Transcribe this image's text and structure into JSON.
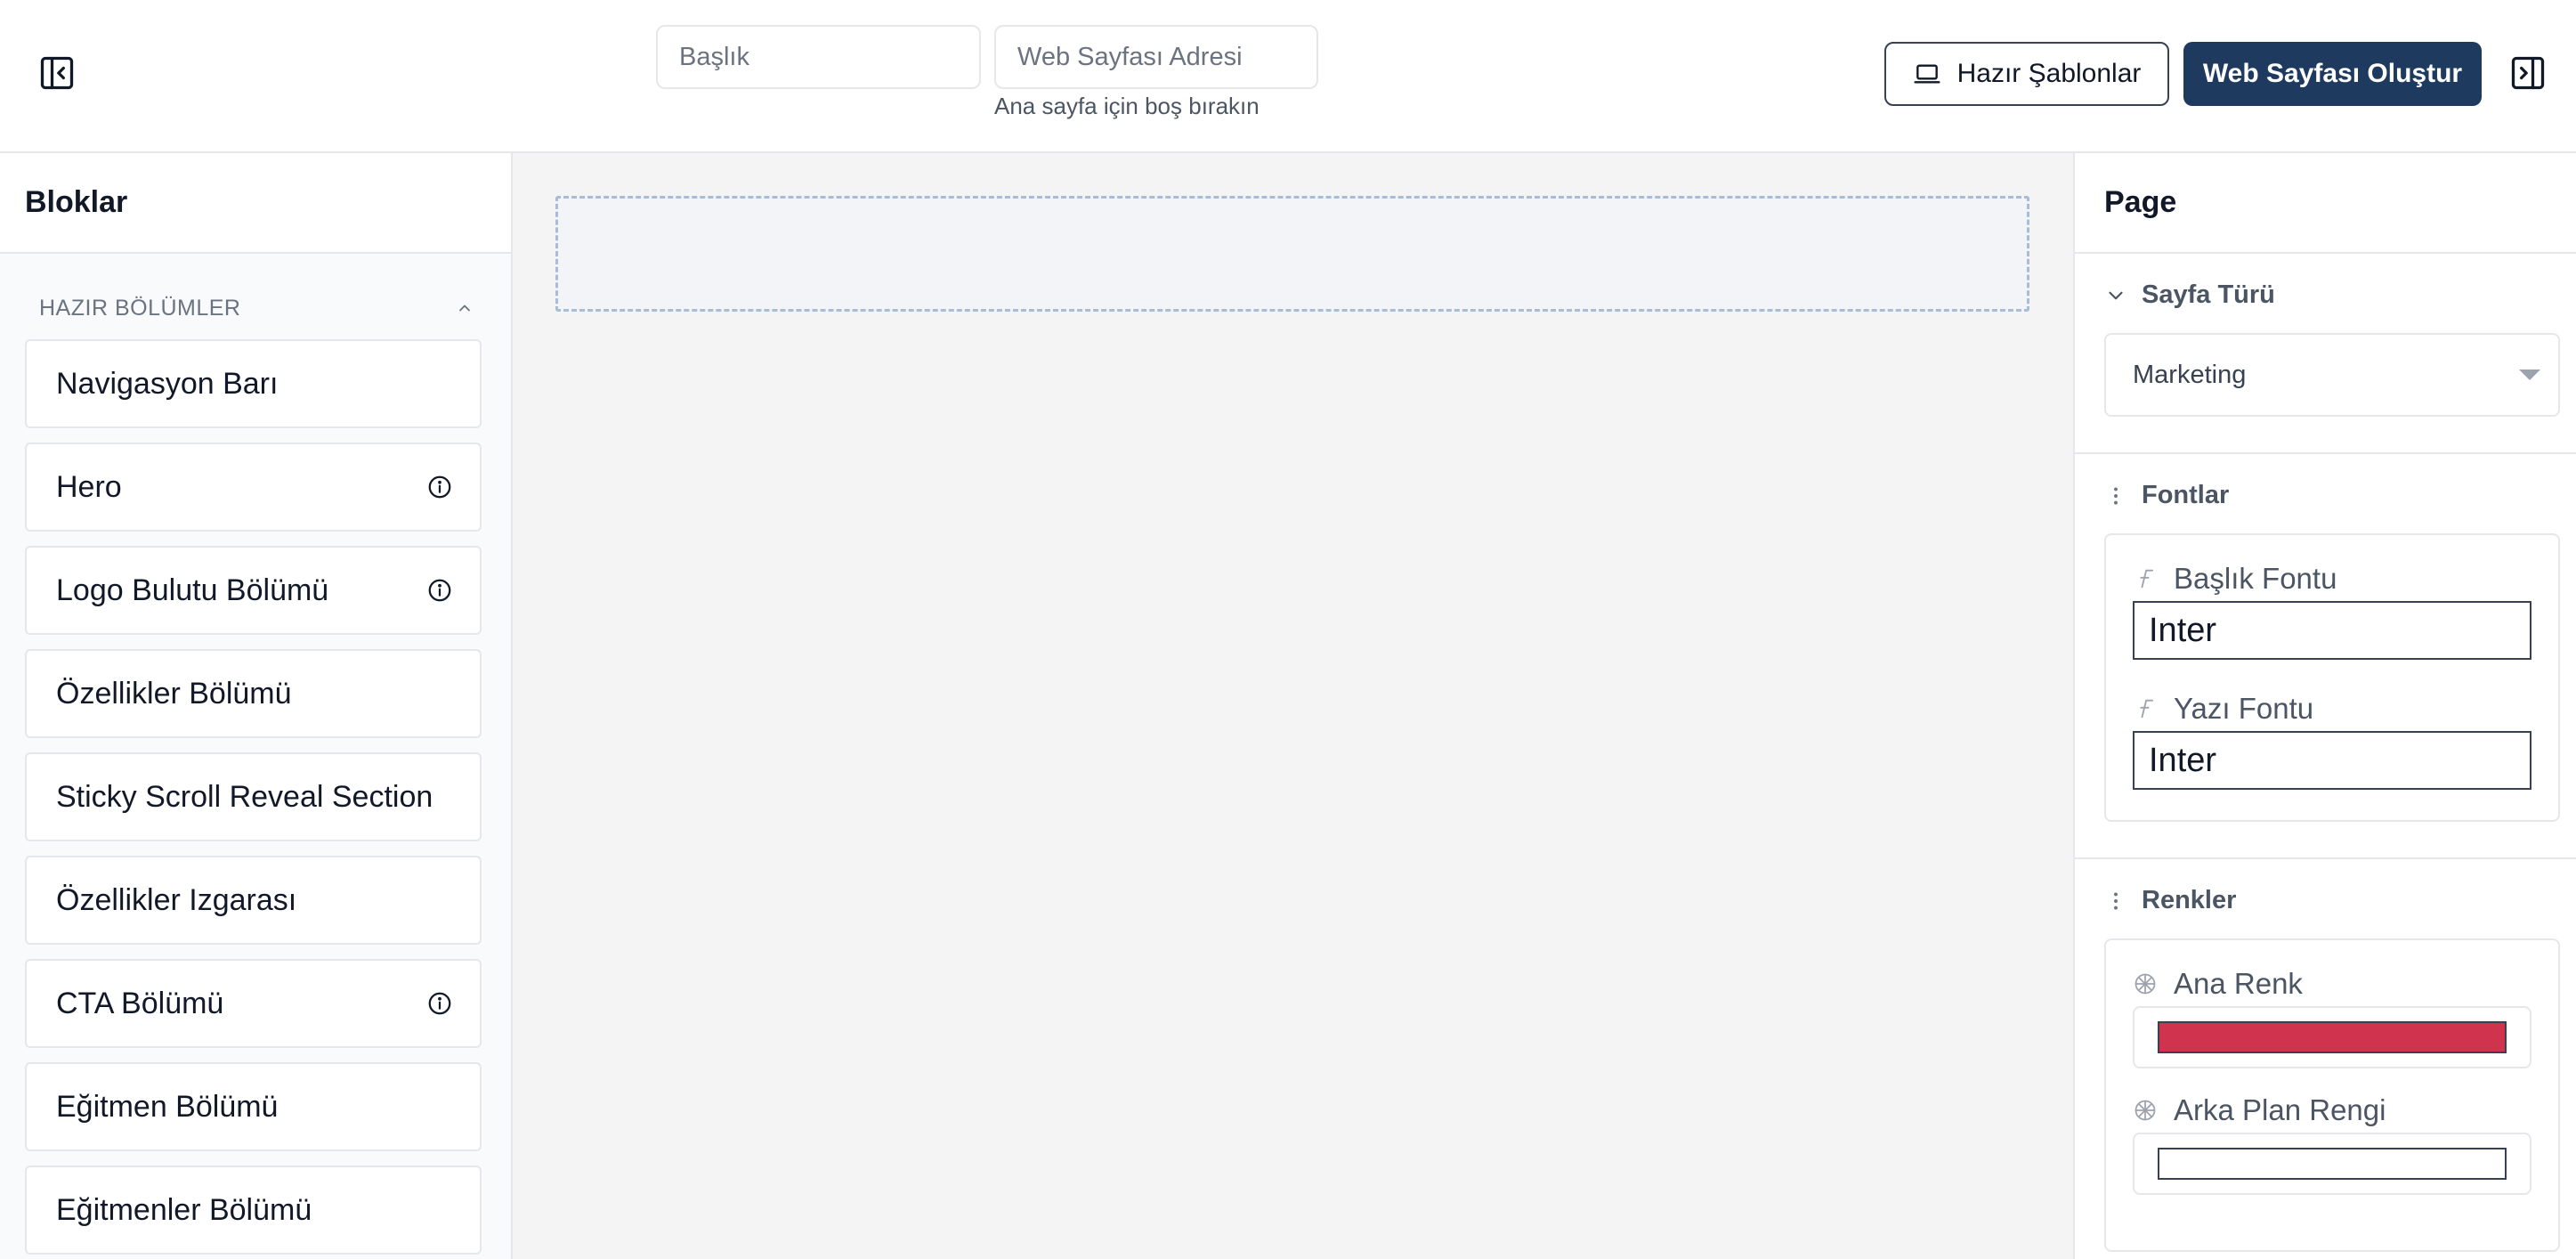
{
  "header": {
    "title_placeholder": "Başlık",
    "url_placeholder": "Web Sayfası Adresi",
    "url_hint": "Ana sayfa için boş bırakın",
    "templates_label": "Hazır Şablonlar",
    "create_label": "Web Sayfası Oluştur"
  },
  "left": {
    "title": "Bloklar",
    "section_title": "HAZIR BÖLÜMLER",
    "items": [
      {
        "label": "Navigasyon Barı"
      },
      {
        "label": "Hero"
      },
      {
        "label": "Logo Bulutu Bölümü"
      },
      {
        "label": "Özellikler Bölümü"
      },
      {
        "label": "Sticky Scroll Reveal Section"
      },
      {
        "label": "Özellikler Izgarası"
      },
      {
        "label": "CTA Bölümü"
      },
      {
        "label": "Eğitmen Bölümü"
      },
      {
        "label": "Eğitmenler Bölümü"
      }
    ]
  },
  "right": {
    "title": "Page",
    "page_type": {
      "title": "Sayfa Türü",
      "value": "Marketing"
    },
    "fonts": {
      "title": "Fontlar",
      "heading_label": "Başlık Fontu",
      "heading_value": "Inter",
      "body_label": "Yazı Fontu",
      "body_value": "Inter"
    },
    "colors": {
      "title": "Renkler",
      "primary_label": "Ana Renk",
      "primary_value": "#d0334d",
      "background_label": "Arka Plan Rengi",
      "background_value": "#ffffff"
    }
  },
  "icons": {
    "left_toggle": "sidebar-collapse-left-icon",
    "right_toggle": "sidebar-collapse-right-icon",
    "templates": "laptop-icon",
    "info": "info-icon",
    "font": "font-icon",
    "color": "palette-icon",
    "drag": "drag-handle-icon"
  },
  "colors": {
    "primary_button": "#1e3a5f",
    "dropzone_border": "#a8bcd6"
  }
}
